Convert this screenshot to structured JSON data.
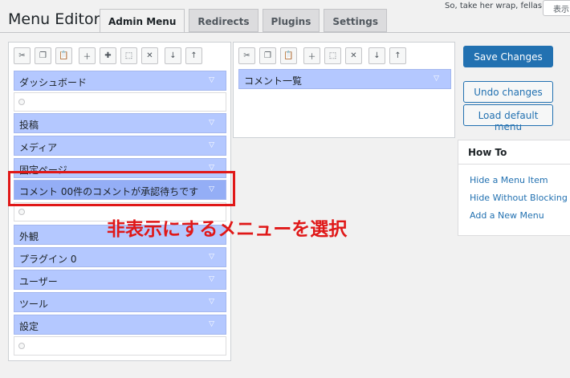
{
  "topbar": {
    "text": "So, take her wrap, fellas",
    "screen_button": "表示"
  },
  "page": {
    "title": "Menu Editor"
  },
  "tabs": [
    {
      "label": "Admin Menu"
    },
    {
      "label": "Redirects"
    },
    {
      "label": "Plugins"
    },
    {
      "label": "Settings"
    }
  ],
  "left_menu": {
    "items": [
      {
        "label": "ダッシュボード"
      },
      {
        "label": "投稿"
      },
      {
        "label": "メディア"
      },
      {
        "label": "固定ページ"
      },
      {
        "label": "コメント 00件のコメントが承認待ちです"
      },
      {
        "label": "外観"
      },
      {
        "label": "プラグイン 0"
      },
      {
        "label": "ユーザー"
      },
      {
        "label": "ツール"
      },
      {
        "label": "設定"
      }
    ]
  },
  "right_menu": {
    "items": [
      {
        "label": "コメント一覧"
      }
    ]
  },
  "actions": {
    "save": "Save Changes",
    "undo": "Undo changes",
    "load_default": "Load default menu"
  },
  "howto": {
    "title": "How To",
    "links": [
      "Hide a Menu Item",
      "Hide Without Blocking Ac",
      "Add a New Menu"
    ]
  },
  "annotation": {
    "text": "非表示にするメニューを選択",
    "color": "#e01818"
  },
  "colors": {
    "menu_item": "#b4c8ff",
    "selected_item": "#94aef6",
    "primary": "#2271b1"
  }
}
